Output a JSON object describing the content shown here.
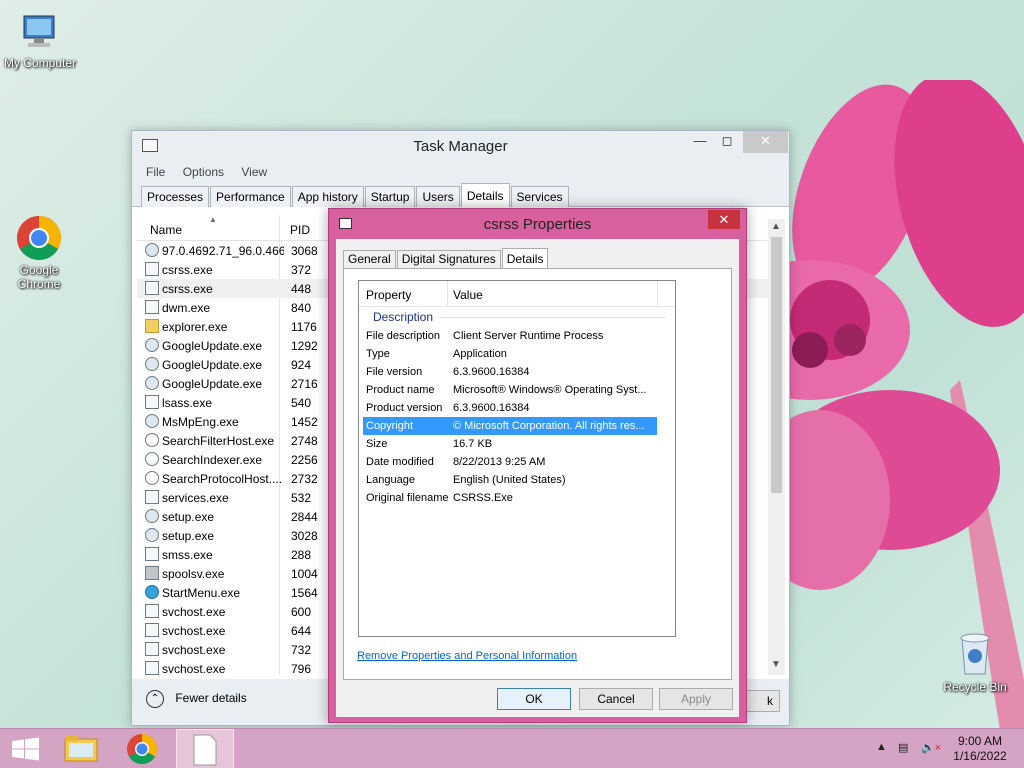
{
  "desktop": {
    "icons": [
      {
        "label": "My Computer"
      },
      {
        "label": "Google Chrome"
      },
      {
        "label": "Recycle Bin"
      }
    ]
  },
  "task_manager": {
    "title": "Task Manager",
    "menu": [
      "File",
      "Options",
      "View"
    ],
    "tabs": [
      "Processes",
      "Performance",
      "App history",
      "Startup",
      "Users",
      "Details",
      "Services"
    ],
    "active_tab": "Details",
    "columns": {
      "name": "Name",
      "pid": "PID"
    },
    "rows": [
      {
        "name": "97.0.4692.71_96.0.466...",
        "pid": "3068",
        "icon": "installer-icon"
      },
      {
        "name": "csrss.exe",
        "pid": "372",
        "icon": "window-icon"
      },
      {
        "name": "csrss.exe",
        "pid": "448",
        "icon": "window-icon"
      },
      {
        "name": "dwm.exe",
        "pid": "840",
        "icon": "window-icon"
      },
      {
        "name": "explorer.exe",
        "pid": "1176",
        "icon": "folder-icon"
      },
      {
        "name": "GoogleUpdate.exe",
        "pid": "1292",
        "icon": "gear-icon"
      },
      {
        "name": "GoogleUpdate.exe",
        "pid": "924",
        "icon": "gear-icon"
      },
      {
        "name": "GoogleUpdate.exe",
        "pid": "2716",
        "icon": "gear-icon"
      },
      {
        "name": "lsass.exe",
        "pid": "540",
        "icon": "window-icon"
      },
      {
        "name": "MsMpEng.exe",
        "pid": "1452",
        "icon": "gear-icon"
      },
      {
        "name": "SearchFilterHost.exe",
        "pid": "2748",
        "icon": "search-icon"
      },
      {
        "name": "SearchIndexer.exe",
        "pid": "2256",
        "icon": "search-icon"
      },
      {
        "name": "SearchProtocolHost....",
        "pid": "2732",
        "icon": "search-icon"
      },
      {
        "name": "services.exe",
        "pid": "532",
        "icon": "window-icon"
      },
      {
        "name": "setup.exe",
        "pid": "2844",
        "icon": "gear-icon"
      },
      {
        "name": "setup.exe",
        "pid": "3028",
        "icon": "gear-icon"
      },
      {
        "name": "smss.exe",
        "pid": "288",
        "icon": "window-icon"
      },
      {
        "name": "spoolsv.exe",
        "pid": "1004",
        "icon": "printer-icon"
      },
      {
        "name": "StartMenu.exe",
        "pid": "1564",
        "icon": "globe-icon"
      },
      {
        "name": "svchost.exe",
        "pid": "600",
        "icon": "window-icon"
      },
      {
        "name": "svchost.exe",
        "pid": "644",
        "icon": "window-icon"
      },
      {
        "name": "svchost.exe",
        "pid": "732",
        "icon": "window-icon"
      },
      {
        "name": "svchost.exe",
        "pid": "796",
        "icon": "window-icon"
      }
    ],
    "selected_row": 2,
    "fewer_details": "Fewer details",
    "end_task": "k"
  },
  "properties": {
    "title": "csrss Properties",
    "tabs": [
      "General",
      "Digital Signatures",
      "Details"
    ],
    "active_tab": "Details",
    "columns": {
      "property": "Property",
      "value": "Value"
    },
    "group": "Description",
    "rows": [
      {
        "k": "File description",
        "v": "Client Server Runtime Process"
      },
      {
        "k": "Type",
        "v": "Application"
      },
      {
        "k": "File version",
        "v": "6.3.9600.16384"
      },
      {
        "k": "Product name",
        "v": "Microsoft® Windows® Operating Syst..."
      },
      {
        "k": "Product version",
        "v": "6.3.9600.16384"
      },
      {
        "k": "Copyright",
        "v": "© Microsoft Corporation. All rights res..."
      },
      {
        "k": "Size",
        "v": "16.7 KB"
      },
      {
        "k": "Date modified",
        "v": "8/22/2013 9:25 AM"
      },
      {
        "k": "Language",
        "v": "English (United States)"
      },
      {
        "k": "Original filename",
        "v": "CSRSS.Exe"
      }
    ],
    "highlighted_row": 5,
    "remove_link": "Remove Properties and Personal Information",
    "buttons": {
      "ok": "OK",
      "cancel": "Cancel",
      "apply": "Apply"
    }
  },
  "taskbar": {
    "time": "9:00 AM",
    "date": "1/16/2022"
  },
  "colors": {
    "accent": "#d8609f",
    "taskbar": "#d5a3c4",
    "highlight": "#3399ff"
  }
}
